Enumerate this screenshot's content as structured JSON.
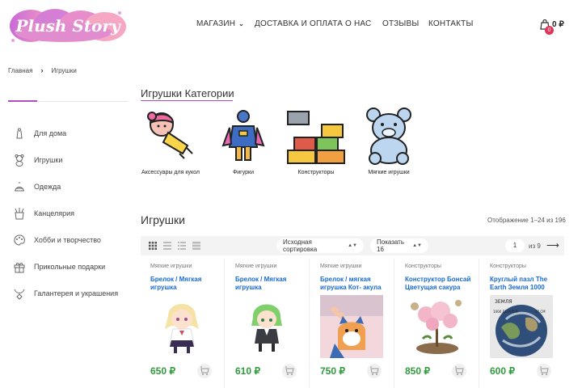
{
  "brand": {
    "logo_text": "Plush Story"
  },
  "nav": {
    "shop": "МАГАЗИН",
    "delivery": "ДОСТАВКА И ОПЛАТА",
    "about": "О НАС",
    "reviews": "ОТЗЫВЫ",
    "contacts": "КОНТАКТЫ"
  },
  "cart": {
    "count": "0",
    "total": "0 ₽"
  },
  "breadcrumb": {
    "home": "Главная",
    "current": "Игрушки"
  },
  "sidebar": {
    "items": [
      {
        "label": "Для дома",
        "icon": "home-decor-icon"
      },
      {
        "label": "Игрушки",
        "icon": "teddy-icon"
      },
      {
        "label": "Одежда",
        "icon": "hat-icon"
      },
      {
        "label": "Канцелярия",
        "icon": "pencil-cup-icon"
      },
      {
        "label": "Хобби и творчество",
        "icon": "palette-icon"
      },
      {
        "label": "Прикольные подарки",
        "icon": "gift-icon"
      },
      {
        "label": "Галантерея и украшения",
        "icon": "jewelry-icon"
      }
    ]
  },
  "categories": {
    "title": "Игрушки Категории",
    "items": [
      {
        "label": "Аксессуары для кукол",
        "icon": "doll-icon"
      },
      {
        "label": "Фигурки",
        "icon": "figure-icon"
      },
      {
        "label": "Конструкторы",
        "icon": "bricks-icon"
      },
      {
        "label": "Мягкие игрушки",
        "icon": "teddy-bear-icon"
      }
    ]
  },
  "products_section": {
    "title": "Игрушки",
    "result_count": "Отображение 1–24 из 196"
  },
  "toolbar": {
    "sort_value": "Исходная сортировка",
    "per_page_value": "Показать 16",
    "page_current": "1",
    "page_of": "из 9"
  },
  "products": [
    {
      "type": "Мягкие игрушки",
      "name": "Брелок / Мягкая игрушка",
      "price": "650 ₽"
    },
    {
      "type": "Мягкие игрушки",
      "name": "Брелок / Мягкая игрушка",
      "price": "610 ₽"
    },
    {
      "type": "Мягкие игрушки",
      "name": "Брелок / мягкая игрушка Кот- акула",
      "price": "750 ₽"
    },
    {
      "type": "Конструкторы",
      "name": "Конструктор Бонсай Цветущая сакура",
      "price": "850 ₽"
    },
    {
      "type": "Конструкторы",
      "name": "Круглый пазл The Earth Земля 1000",
      "price": "600 ₽"
    }
  ],
  "product_image_text": {
    "puzzle_top": "ЗЕМЛЯ",
    "puzzle_left": "1000 ДЕТАЛЕЙ",
    "puzzle_right": "67 СМ"
  },
  "colors": {
    "accent": "#b04fc0",
    "price": "#2e9a3c",
    "link": "#1a6ad0",
    "badge": "#e0345b"
  }
}
